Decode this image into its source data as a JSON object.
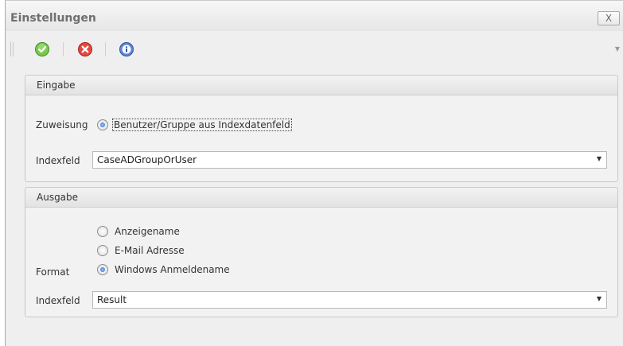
{
  "window": {
    "title": "Einstellungen",
    "close_label": "X"
  },
  "toolbar": {
    "items": [
      {
        "name": "ok",
        "icon": "check-circle-icon",
        "color": "#59b93a"
      },
      {
        "name": "cancel",
        "icon": "cancel-circle-icon",
        "color": "#d9322b"
      },
      {
        "name": "info",
        "icon": "info-circle-icon",
        "color": "#3b69c6"
      }
    ]
  },
  "input_group": {
    "title": "Eingabe",
    "assignment_label": "Zuweisung",
    "assignment_option": "Benutzer/Gruppe aus Indexdatenfeld",
    "indexfield_label": "Indexfeld",
    "indexfield_value": "CaseADGroupOrUser"
  },
  "output_group": {
    "title": "Ausgabe",
    "format_label": "Format",
    "format_options": [
      {
        "label": "Anzeigename",
        "checked": false
      },
      {
        "label": "E-Mail Adresse",
        "checked": false
      },
      {
        "label": "Windows Anmeldename",
        "checked": true
      }
    ],
    "indexfield_label": "Indexfeld",
    "indexfield_value": "Result"
  }
}
